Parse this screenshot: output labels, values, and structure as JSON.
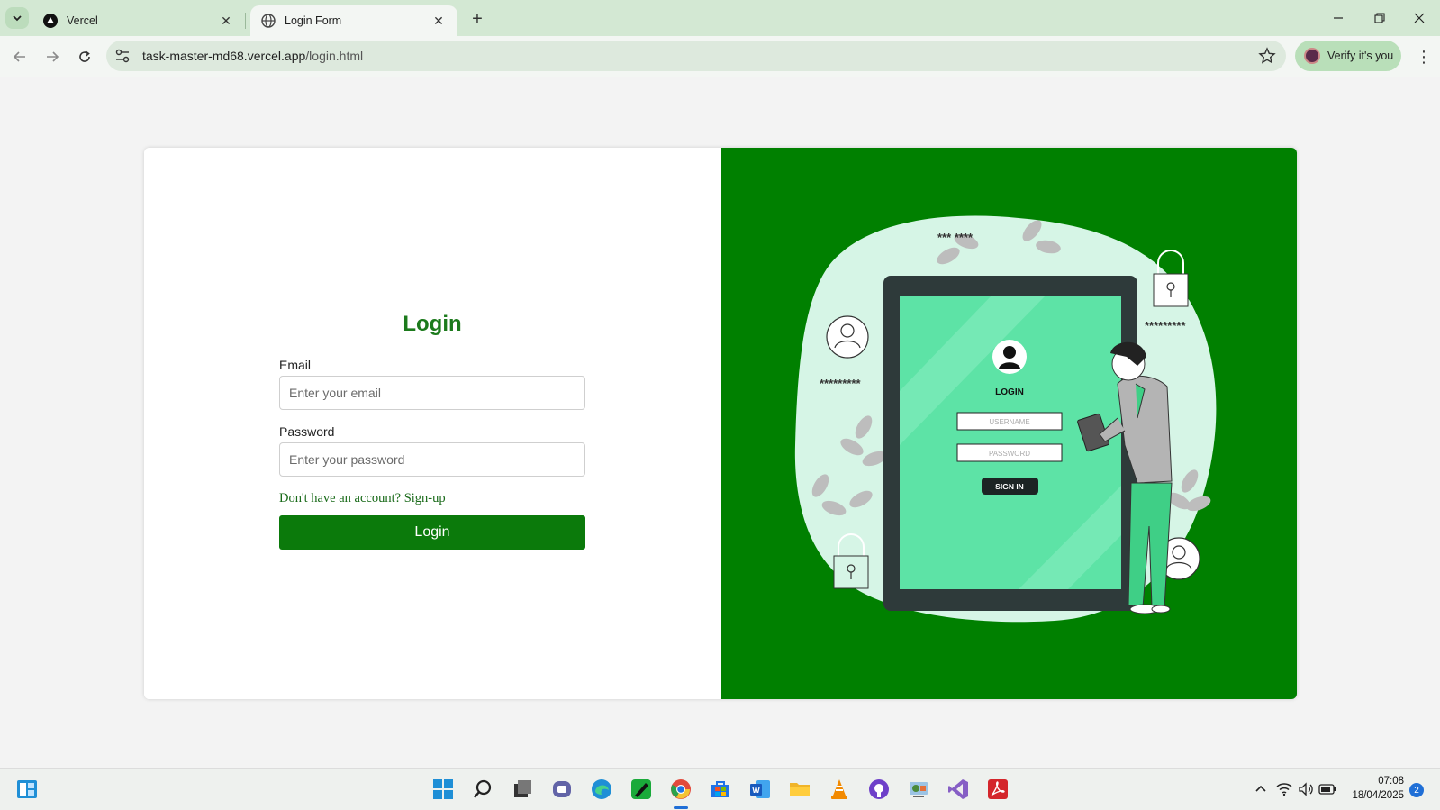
{
  "browser": {
    "tabs": [
      {
        "title": "Vercel",
        "icon": "vercel-icon",
        "active": false
      },
      {
        "title": "Login Form",
        "icon": "globe-icon",
        "active": true
      }
    ],
    "url_domain": "task-master-md68.vercel.app",
    "url_path": "/login.html",
    "verify_label": "Verify it's you"
  },
  "login": {
    "title": "Login",
    "email_label": "Email",
    "email_placeholder": "Enter your email",
    "password_label": "Password",
    "password_placeholder": "Enter your password",
    "signup_link": "Don't have an account? Sign-up",
    "button_label": "Login"
  },
  "illustration": {
    "screen_heading": "LOGIN",
    "username_placeholder": "USERNAME",
    "password_placeholder": "PASSWORD",
    "signin_label": "SIGN IN",
    "masked_text": "*********",
    "masked_text_top": "*** ****"
  },
  "colors": {
    "brand_green": "#008000",
    "title_green": "#1c7a1c",
    "button_green": "#0b7a0b"
  },
  "taskbar": {
    "time": "07:08",
    "date": "18/04/2025",
    "notifications": "2"
  }
}
